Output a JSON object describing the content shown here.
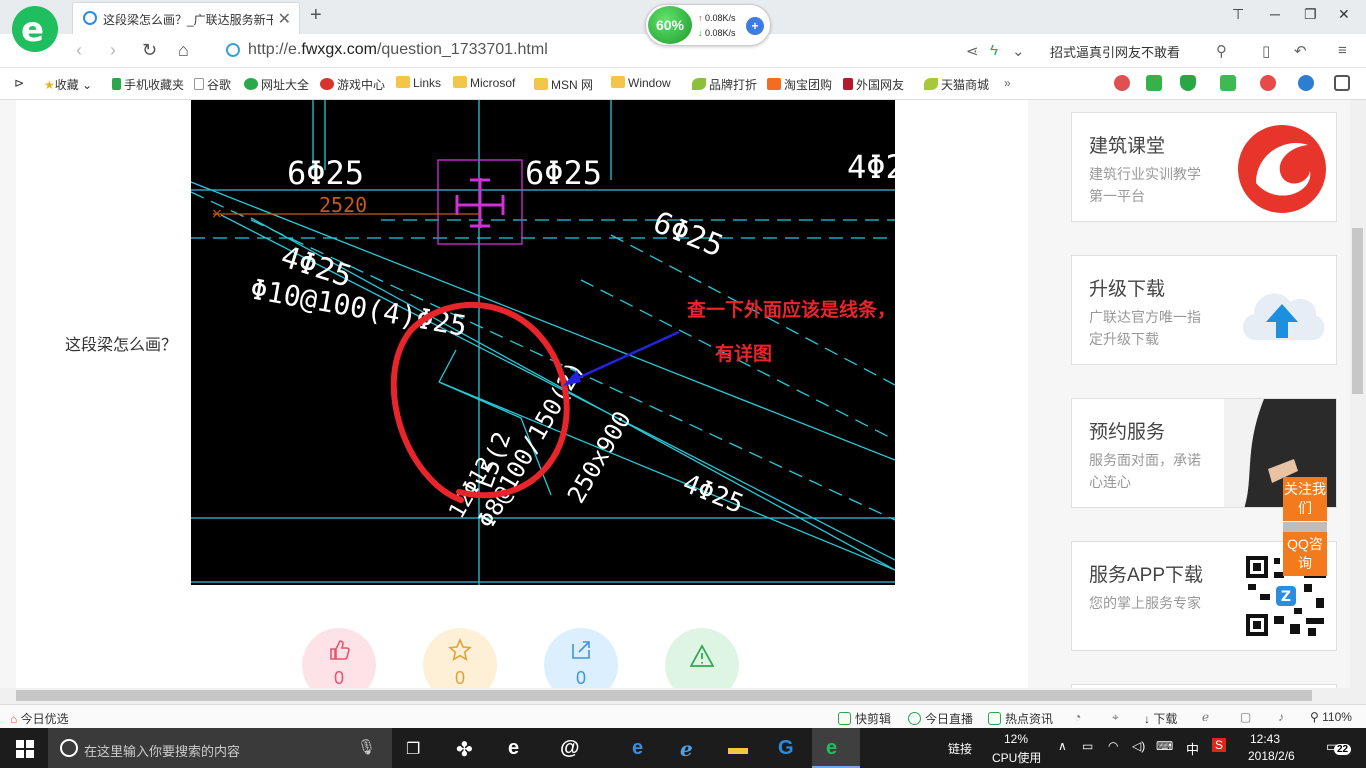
{
  "browser": {
    "tab_title": "这段梁怎么画？_广联达服务新干线",
    "new_tab_symbol": "+",
    "speed": {
      "percent": "60%",
      "upload": "0.08K/s",
      "download": "0.08K/s"
    },
    "url_prefix": "http://e.",
    "url_domain": "fwxgx.com",
    "url_path": "/question_1733701.html",
    "search_hint": "招式逼真引网友不敢看"
  },
  "bookmarks": [
    {
      "label": "收藏",
      "icon": "star-icon"
    },
    {
      "label": "手机收藏夹",
      "icon": "phone-icon"
    },
    {
      "label": "谷歌",
      "icon": "page-icon"
    },
    {
      "label": "网址大全",
      "icon": "globe-icon"
    },
    {
      "label": "游戏中心",
      "icon": "game-icon"
    },
    {
      "label": "Links",
      "icon": "folder-icon"
    },
    {
      "label": "Microsof",
      "icon": "folder-icon"
    },
    {
      "label": "MSN 网",
      "icon": "folder-icon"
    },
    {
      "label": "Window",
      "icon": "folder-icon"
    },
    {
      "label": "品牌打折",
      "icon": "leaf-icon"
    },
    {
      "label": "淘宝团购",
      "icon": "taobao-icon"
    },
    {
      "label": "外国网友",
      "icon": "page-icon"
    },
    {
      "label": "天猫商城",
      "icon": "leaf-icon"
    }
  ],
  "question": {
    "text": "这段梁怎么画？",
    "cad_labels": {
      "rebar_left": "6Φ25",
      "rebar_mid": "6Φ25",
      "rebar_right": "4Φ2",
      "dimension": "2520",
      "rebar_diag": "6Φ25",
      "rebar_left2": "4Φ25",
      "stirrup": "Φ10@100(4)Φ25",
      "rebar_lower": "4Φ25",
      "beam_code": "L5(2",
      "beam_stirrup": "Φ8@100/150(2)",
      "beam_size": "250x900",
      "bottom": "12Φ12"
    },
    "annotation_line1": "查一下外面应该是线条，看一下是否",
    "annotation_line2": "有详图"
  },
  "actions": [
    {
      "name": "like",
      "count": "0",
      "color": "#fde3e8",
      "fg": "#e8546f"
    },
    {
      "name": "favorite",
      "count": "0",
      "color": "#fdf0d6",
      "fg": "#e2a33a"
    },
    {
      "name": "share",
      "count": "0",
      "color": "#dcefff",
      "fg": "#3e95de"
    },
    {
      "name": "report",
      "count": "",
      "color": "#dff5e4",
      "fg": "#31a852"
    }
  ],
  "sidebar": [
    {
      "title": "建筑课堂",
      "desc": "建筑行业实训教学第一平台"
    },
    {
      "title": "升级下载",
      "desc": "广联达官方唯一指定升级下载"
    },
    {
      "title": "预约服务",
      "desc": "服务面对面，承诺心连心"
    },
    {
      "title": "服务APP下载",
      "desc": "您的掌上服务专家"
    }
  ],
  "float_buttons": {
    "follow": "关注我们",
    "qq": "QQ咨询"
  },
  "statusbar": {
    "left": "今日优选",
    "items": [
      "快剪辑",
      "今日直播",
      "热点资讯"
    ],
    "download": "下载",
    "zoom": "110%"
  },
  "taskbar": {
    "search_placeholder": "在这里输入你要搜索的内容",
    "links_label": "链接",
    "cpu_percent": "12%",
    "cpu_label": "CPU使用",
    "ime": "中",
    "time": "12:43",
    "date": "2018/2/6",
    "notifications": "22"
  },
  "colors": {
    "accent_green": "#1fbf5f",
    "cad_cyan": "#28c8d8",
    "annotation_red": "#e8252b",
    "float_orange": "#f37b1d"
  }
}
